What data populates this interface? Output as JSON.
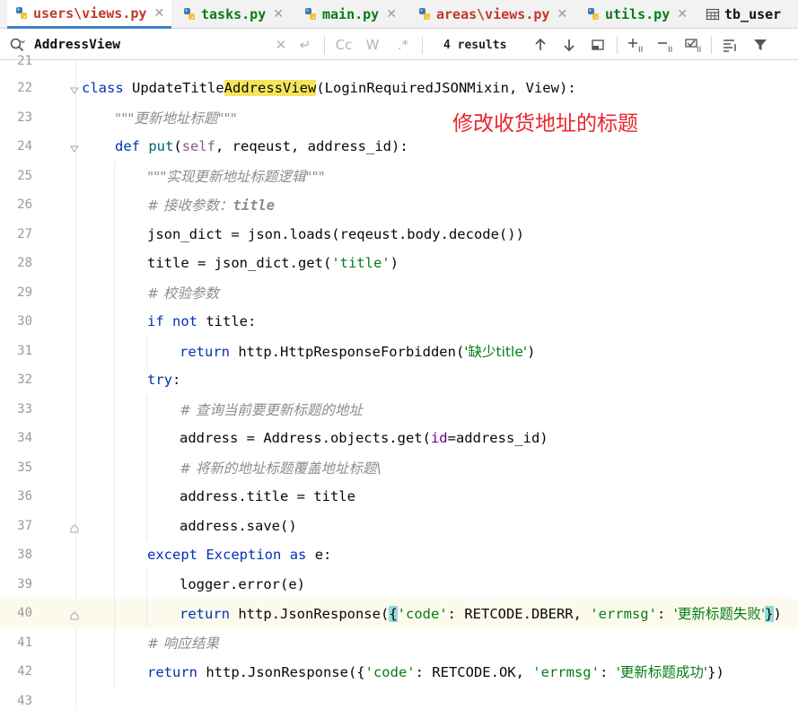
{
  "tabs": [
    {
      "label": "users\\views.py",
      "active": true,
      "color": "#c0392b",
      "icon": "python-file-icon"
    },
    {
      "label": "tasks.py",
      "active": false,
      "color": "#067d17",
      "icon": "python-file-icon"
    },
    {
      "label": "main.py",
      "active": false,
      "color": "#067d17",
      "icon": "python-file-icon"
    },
    {
      "label": "areas\\views.py",
      "active": false,
      "color": "#c0392b",
      "icon": "python-file-icon"
    },
    {
      "label": "utils.py",
      "active": false,
      "color": "#067d17",
      "icon": "python-file-icon"
    },
    {
      "label": "tb_user",
      "active": false,
      "color": "#111111",
      "icon": "table-icon"
    }
  ],
  "search": {
    "query": "AddressView",
    "results": "4 results",
    "case_label": "Cc",
    "words_label": "W",
    "regex_label": ".*"
  },
  "annotation": "修改收货地址的标题",
  "lines": [
    {
      "n": "21"
    },
    {
      "n": "22",
      "t": {
        "kw1": "class",
        "name_pre": "UpdateTitle",
        "name_match": "AddressView",
        "rest": "(LoginRequiredJSONMixin, View):"
      }
    },
    {
      "n": "23",
      "t": {
        "doc": "\"\"\"更新地址标题\"\"\""
      }
    },
    {
      "n": "24",
      "t": {
        "kw1": "def",
        "fn": "put",
        "p1": "(",
        "self": "self",
        "rest": ", reqeust, address_id):"
      }
    },
    {
      "n": "25",
      "t": {
        "doc": "\"\"\"实现更新地址标题逻辑\"\"\""
      }
    },
    {
      "n": "26",
      "t": {
        "cmt": "# 接收参数：",
        "cmtkw": "title"
      }
    },
    {
      "n": "27",
      "t": {
        "code": "json_dict = json.loads(reqeust.body.decode())"
      }
    },
    {
      "n": "28",
      "t": {
        "pre": "title = json_dict.get(",
        "str": "'title'",
        "post": ")"
      }
    },
    {
      "n": "29",
      "t": {
        "cmt": "# 校验参数"
      }
    },
    {
      "n": "30",
      "t": {
        "kw1": "if",
        "kw2": "not",
        "rest": " title:"
      }
    },
    {
      "n": "31",
      "t": {
        "kw1": "return",
        "pre": " http.HttpResponseForbidden(",
        "str": "'缺少title'",
        "post": ")"
      }
    },
    {
      "n": "32",
      "t": {
        "kw1": "try",
        "rest": ":"
      }
    },
    {
      "n": "33",
      "t": {
        "cmt": "# 查询当前要更新标题的地址"
      }
    },
    {
      "n": "34",
      "t": {
        "pre": "address = Address.objects.get(",
        "kwarg": "id",
        "post": "=address_id)"
      }
    },
    {
      "n": "35",
      "t": {
        "cmt": "# 将新的地址标题覆盖地址标题\\"
      }
    },
    {
      "n": "36",
      "t": {
        "code": "address.title = title"
      }
    },
    {
      "n": "37",
      "t": {
        "code": "address.save()"
      }
    },
    {
      "n": "38",
      "t": {
        "kw1": "except",
        "exc": "Exception",
        "kw2": "as",
        "rest": " e:"
      }
    },
    {
      "n": "39",
      "t": {
        "code": "logger.error(e)"
      }
    },
    {
      "n": "40",
      "t": {
        "kw1": "return",
        "pre": " http.JsonResponse(",
        "b1": "{",
        "s1": "'code'",
        "m1": ": RETCODE.DBERR, ",
        "s2": "'errmsg'",
        "m2": ": ",
        "s3": "'更新标题失败'",
        "b2": "}",
        "post": ")"
      }
    },
    {
      "n": "41",
      "t": {
        "cmt": "# 响应结果"
      }
    },
    {
      "n": "42",
      "t": {
        "kw1": "return",
        "pre": " http.JsonResponse({",
        "s1": "'code'",
        "m1": ": RETCODE.OK, ",
        "s2": "'errmsg'",
        "m2": ": ",
        "s3": "'更新标题成功'",
        "post": "})"
      }
    },
    {
      "n": "43"
    }
  ]
}
